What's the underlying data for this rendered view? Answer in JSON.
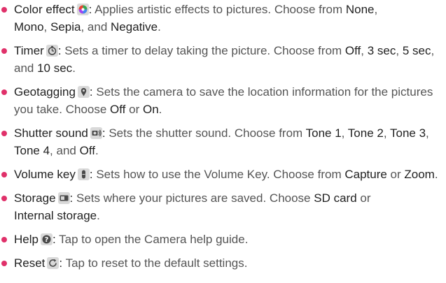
{
  "colors": {
    "bullet": "#e0316a"
  },
  "items": [
    {
      "term": "Color effect",
      "icon": "color-effect-icon",
      "colon": ":",
      "text1": " Applies artistic effects to pictures. Choose from ",
      "opt1": "None",
      "sep1": ",",
      "opt2": "Mono",
      "sep2": ", ",
      "opt3": "Sepia",
      "sep3": ", and ",
      "opt4": "Negative",
      "end": "."
    },
    {
      "term": "Timer",
      "icon": "timer-icon",
      "colon": ":",
      "text1": " Sets a timer to delay taking the picture. Choose from ",
      "opt1": "Off",
      "sep1": ", ",
      "opt2": "3 sec",
      "sep2": ", ",
      "opt3": "5 sec",
      "sep3": ", and ",
      "opt4": "10 sec",
      "end": "."
    },
    {
      "term": "Geotagging",
      "icon": "geotagging-icon",
      "colon": ":",
      "text1": " Sets the camera to save the location information for the pictures you take. Choose ",
      "opt1": "Off",
      "sep1": " or ",
      "opt2": "On",
      "end": "."
    },
    {
      "term": "Shutter sound",
      "icon": "shutter-sound-icon",
      "colon": ":",
      "text1": " Sets the shutter sound. Choose from ",
      "opt1": "Tone 1",
      "sep1": ", ",
      "opt2": "Tone 2",
      "sep2": ", ",
      "opt3": "Tone 3",
      "sep3": ", ",
      "opt4": "Tone 4",
      "sep4": ", and ",
      "opt5": "Off",
      "end": "."
    },
    {
      "term": "Volume key",
      "icon": "volume-key-icon",
      "colon": ":",
      "text1": " Sets how to use the Volume Key. Choose from ",
      "opt1": "Capture",
      "sep1": " or ",
      "opt2": "Zoom",
      "end": "."
    },
    {
      "term": "Storage",
      "icon": "storage-icon",
      "colon": ":",
      "text1": " Sets where your pictures are saved. Choose ",
      "opt1": "SD card",
      "sep1": " or ",
      "opt2": "Internal storage",
      "end": "."
    },
    {
      "term": "Help",
      "icon": "help-icon",
      "colon": ":",
      "text1": " Tap to open the Camera help guide."
    },
    {
      "term": "Reset",
      "icon": "reset-icon",
      "colon": ":",
      "text1": " Tap to reset to the default settings."
    }
  ]
}
